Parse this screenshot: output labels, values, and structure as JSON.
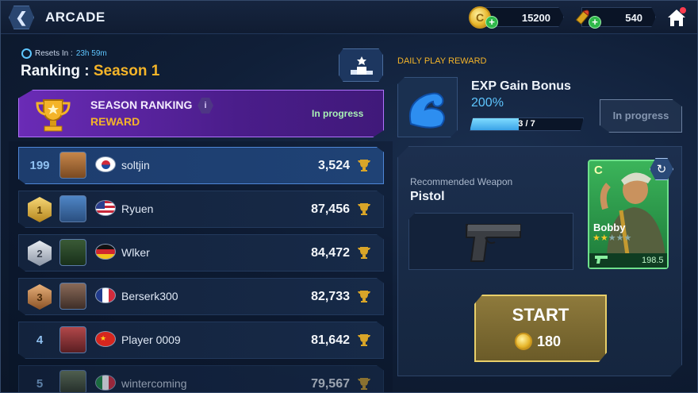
{
  "header": {
    "title": "ARCADE",
    "gold": "15200",
    "ammo": "540"
  },
  "ranking": {
    "resets_label": "Resets In :",
    "resets_time": "23h 59m",
    "title": "Ranking :",
    "season": "Season 1",
    "banner_title": "SEASON RANKING",
    "banner_sub": "REWARD",
    "banner_status": "In progress",
    "info_icon": "i",
    "rows": [
      {
        "rank": "199",
        "name": "soltjin",
        "score": "3,524",
        "flag": "kr",
        "me": true
      },
      {
        "rank": "1",
        "name": "Ryuen",
        "score": "87,456",
        "flag": "us",
        "badge": "gold"
      },
      {
        "rank": "2",
        "name": "Wlker",
        "score": "84,472",
        "flag": "de",
        "badge": "silver"
      },
      {
        "rank": "3",
        "name": "Berserk300",
        "score": "82,733",
        "flag": "fr",
        "badge": "bronze"
      },
      {
        "rank": "4",
        "name": "Player 0009",
        "score": "81,642",
        "flag": "cn"
      },
      {
        "rank": "5",
        "name": "wintercoming",
        "score": "79,567",
        "flag": "it"
      }
    ]
  },
  "daily": {
    "label": "DAILY PLAY REWARD",
    "title": "EXP Gain Bonus",
    "pct": "200%",
    "progress_text": "3 / 7",
    "progress_fraction": 0.43,
    "button": "In progress"
  },
  "weapon": {
    "label": "Recommended Weapon",
    "name": "Pistol"
  },
  "character": {
    "grade": "C",
    "name": "Bobby",
    "stars_on": "★★",
    "stars_off": "★★★",
    "power": "198.5"
  },
  "start": {
    "label": "START",
    "cost": "180"
  },
  "colors": {
    "accent_gold": "#f4b429",
    "accent_blue": "#5ec6ff",
    "season_purple": "#6a2bb6",
    "char_green": "#3bb45a"
  },
  "icons": [
    "back-icon",
    "coin-icon",
    "bullet-icon",
    "plus-icon",
    "home-icon",
    "stopwatch-icon",
    "podium-icon",
    "trophy-icon",
    "info-icon",
    "cup-icon",
    "flexed-arm-icon",
    "pistol-icon",
    "refresh-icon"
  ]
}
